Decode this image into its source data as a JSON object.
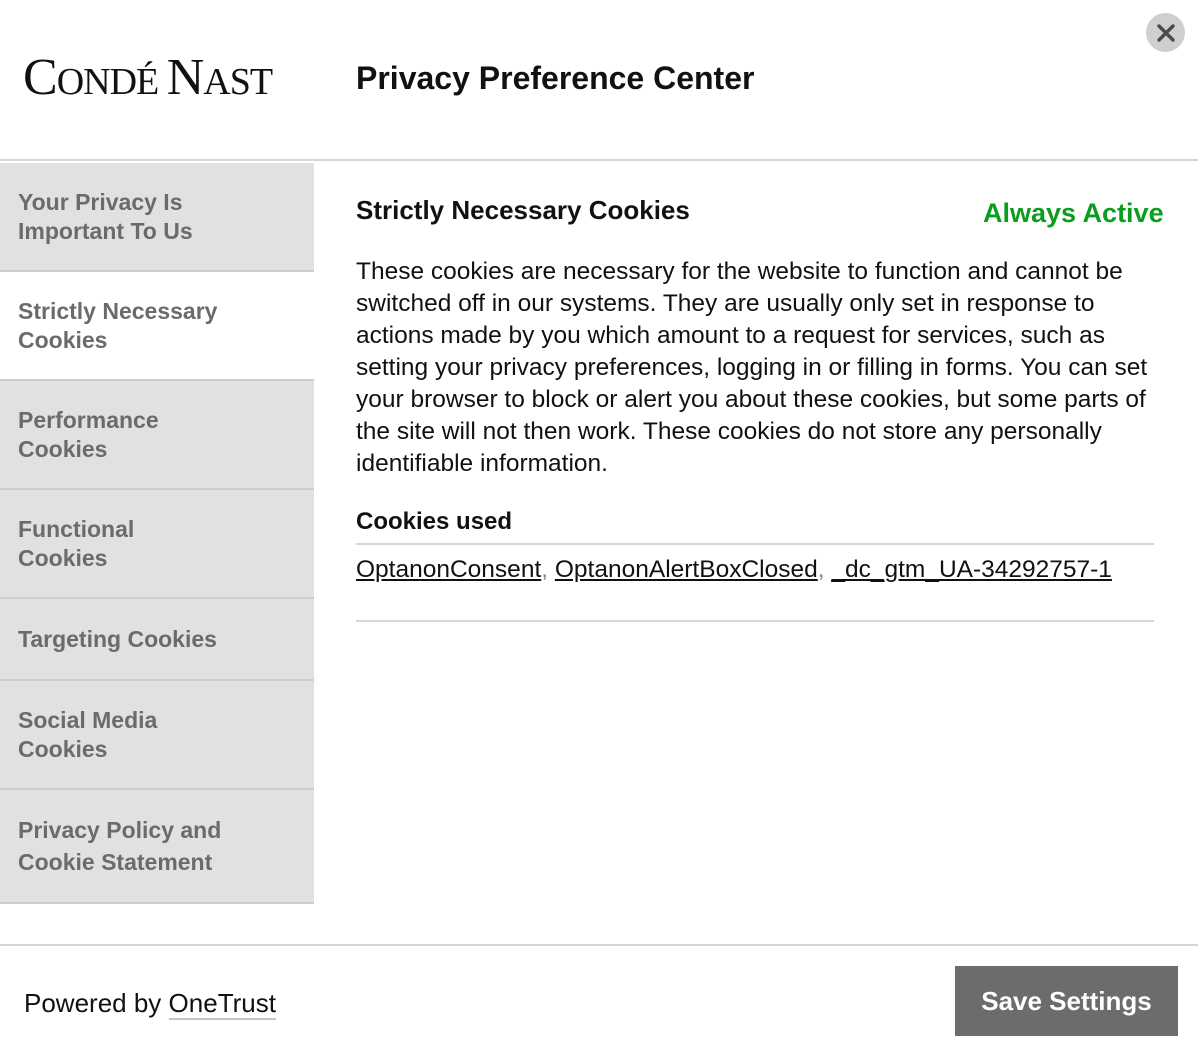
{
  "header": {
    "logo_main": "Condé Nast",
    "title": "Privacy Preference Center",
    "close_icon": "close-icon"
  },
  "sidebar": {
    "items": [
      {
        "label": "Your Privacy Is Important To Us",
        "active": false
      },
      {
        "label": "Strictly Necessary Cookies",
        "active": true
      },
      {
        "label": "Performance Cookies",
        "active": false
      },
      {
        "label": "Functional Cookies",
        "active": false
      },
      {
        "label": "Targeting Cookies",
        "active": false
      },
      {
        "label": "Social Media Cookies",
        "active": false
      },
      {
        "label": "Privacy Policy and Cookie Statement",
        "active": false
      }
    ]
  },
  "content": {
    "section_title": "Strictly Necessary Cookies",
    "status": "Always Active",
    "status_color": "#0b9e1c",
    "description": "These cookies are necessary for the website to function and cannot be switched off in our systems. They are usually only set in response to actions made by you which amount to a request for services, such as setting your privacy preferences, logging in or filling in forms. You can set your browser to block or alert you about these cookies, but some parts of the site will not then work. These cookies do not store any personally identifiable information.",
    "cookies_used_label": "Cookies used",
    "cookies": [
      "OptanonConsent",
      "OptanonAlertBoxClosed",
      "_dc_gtm_UA-34292757-1"
    ],
    "separator": ","
  },
  "footer": {
    "powered_prefix": "Powered by",
    "powered_link": "OneTrust",
    "save_label": "Save Settings",
    "save_color": "#6c6c6c"
  }
}
